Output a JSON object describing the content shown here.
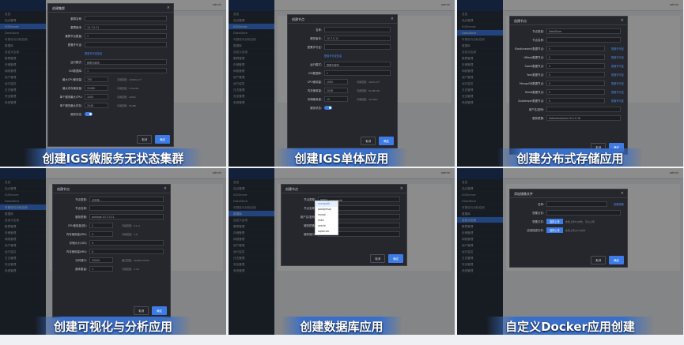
{
  "sidebar_common": {
    "logo": "",
    "items": [
      "总览",
      "站点管理",
      "IGSServer",
      "DataStore",
      "可视化与分析应用",
      "数据库",
      "自定义应用",
      "集群管理",
      "存储管理",
      "网络管理",
      "用户管理",
      "运行监控",
      "日志管理",
      "安全管理",
      "系统管理"
    ]
  },
  "topbar": {
    "user": "admin"
  },
  "panels": [
    {
      "caption": "创建IGS微服务无状态集群",
      "modal_title": "创建集群",
      "rows": [
        {
          "label": "集群名称:",
          "value": ""
        },
        {
          "label": "集群版本:",
          "value": "10.7.0.11"
        },
        {
          "label": "集群节点数量:",
          "value": "1"
        },
        {
          "label": "配置许可证:",
          "value": ""
        },
        {
          "label": "",
          "value": "",
          "link": "配置许可证信息"
        },
        {
          "label": "运行模式:",
          "value": "数据与服务"
        },
        {
          "label": "GIS数据库:",
          "value": "1"
        },
        {
          "label": "最大CPU使用量:",
          "value": "750",
          "hint": "可用范围：1000m-2个"
        },
        {
          "label": "最大内存使用量:",
          "value": "20480",
          "hint": "可用范围：0.5G-8G"
        },
        {
          "label": "单个服务最大CPU:",
          "value": "1000",
          "hint": "可用范围：100m"
        },
        {
          "label": "单个服务最大内存:",
          "value": "2048",
          "hint": "可用范围：512Mi"
        },
        {
          "label": "服务状态:",
          "toggle": true
        }
      ],
      "cancel": "取消",
      "ok": "确定"
    },
    {
      "caption": "创建IGS单体应用",
      "modal_title": "创建节点",
      "rows": [
        {
          "label": "名称:",
          "value": ""
        },
        {
          "label": "服务版本:",
          "value": "10.7.0.11"
        },
        {
          "label": "配置许可证:",
          "value": ""
        },
        {
          "label": "",
          "value": "",
          "link": "配置许可证信息"
        },
        {
          "label": "运行模式:",
          "value": "数据与服务"
        },
        {
          "label": "GIS数据库:",
          "value": "1"
        },
        {
          "label": "CPU使用量:",
          "value": "1000",
          "hint": "可用范围：100m-4个"
        },
        {
          "label": "内存使用量:",
          "value": "2048",
          "hint": "可用范围：512Mi-8G"
        },
        {
          "label": "存储使用量:",
          "value": "10",
          "hint": "可用范围：1G-50G"
        },
        {
          "label": "服务状态:",
          "toggle": true
        }
      ],
      "cancel": "取消",
      "ok": "确定"
    },
    {
      "caption": "创建分布式存储应用",
      "modal_title": "创建节点",
      "rows": [
        {
          "label": "节点类型:",
          "value": "DataStore"
        },
        {
          "label": "节点名称:",
          "value": ""
        },
        {
          "label": "Elasticsearch数据节点:",
          "value": "0",
          "link": "配置许可证"
        },
        {
          "label": "HBase数据节点:",
          "value": "0",
          "link": "配置许可证"
        },
        {
          "label": "Spark数据节点:",
          "value": "0",
          "link": "配置许可证"
        },
        {
          "label": "Yarn数据节点:",
          "value": "0",
          "link": "配置许可证"
        },
        {
          "label": "MongoDB数据节点:",
          "value": "0",
          "link": "配置许可证"
        },
        {
          "label": "Redis数据节点:",
          "value": "0",
          "link": "配置许可证"
        },
        {
          "label": "Zookeeper数据节点:",
          "value": "0",
          "link": "配置许可证"
        },
        {
          "label": "用户名/密码:",
          "value": ""
        },
        {
          "label": "服务镜像:",
          "value": "datastore/base:10.2.0.16"
        }
      ],
      "cancel": "取消",
      "ok": "确定"
    },
    {
      "caption": "创建可视化与分析应用",
      "modal_title": "创建节点",
      "rows": [
        {
          "label": "节点类型:",
          "value": "请选择..."
        },
        {
          "label": "节点名称:",
          "value": ""
        },
        {
          "label": "服务镜像:",
          "value": "portage:10.7.0.11"
        },
        {
          "label": "CPU使用量(核):",
          "value": "2",
          "hint": "可用范围：0.1-4"
        },
        {
          "label": "内存使用量(MB):",
          "value": "4",
          "hint": "可用范围：1-8"
        },
        {
          "label": "存储大小(GB):",
          "value": "4"
        },
        {
          "label": "内存使用量(MB):",
          "value": "8"
        },
        {
          "label": "访问端口:",
          "value": "30000",
          "hint": "端口范围：30000-32767"
        },
        {
          "label": "副本数量:",
          "value": "1",
          "hint": "可用范围：1-10"
        }
      ],
      "cancel": "取消",
      "ok": "确定"
    },
    {
      "caption": "创建数据库应用",
      "modal_title": "创建节点",
      "rows": [
        {
          "label": "节点类型:",
          "value": "数据库 / mongodb"
        },
        {
          "label": "节点名称:",
          "value": ""
        },
        {
          "label": "用户名/密码:",
          "value": ""
        },
        {
          "label": "服务镜像:",
          "value": "mongodb:4"
        },
        {
          "label": "服务端口:",
          "value": "27017"
        }
      ],
      "dropdown": [
        "mongodb",
        "postgresql",
        "mysql",
        "redis",
        "oracle",
        "sqlserver"
      ],
      "cancel": "取消",
      "ok": "确定"
    },
    {
      "caption": "自定义Docker应用创建",
      "modal_title": "添加镜像文件",
      "rows": [
        {
          "label": "名称:",
          "value": "",
          "link": "配置镜像"
        },
        {
          "label": "镜像文件:",
          "value": ""
        },
        {
          "label": "镜像文件:",
          "upload": "选择上传",
          "hint": "支持上传tar文件，可以上传"
        },
        {
          "label": "应用描述文件:",
          "upload": "选择上传",
          "hint": "支持上传yaml文件"
        }
      ],
      "cancel": "取消",
      "ok": "确定"
    }
  ]
}
